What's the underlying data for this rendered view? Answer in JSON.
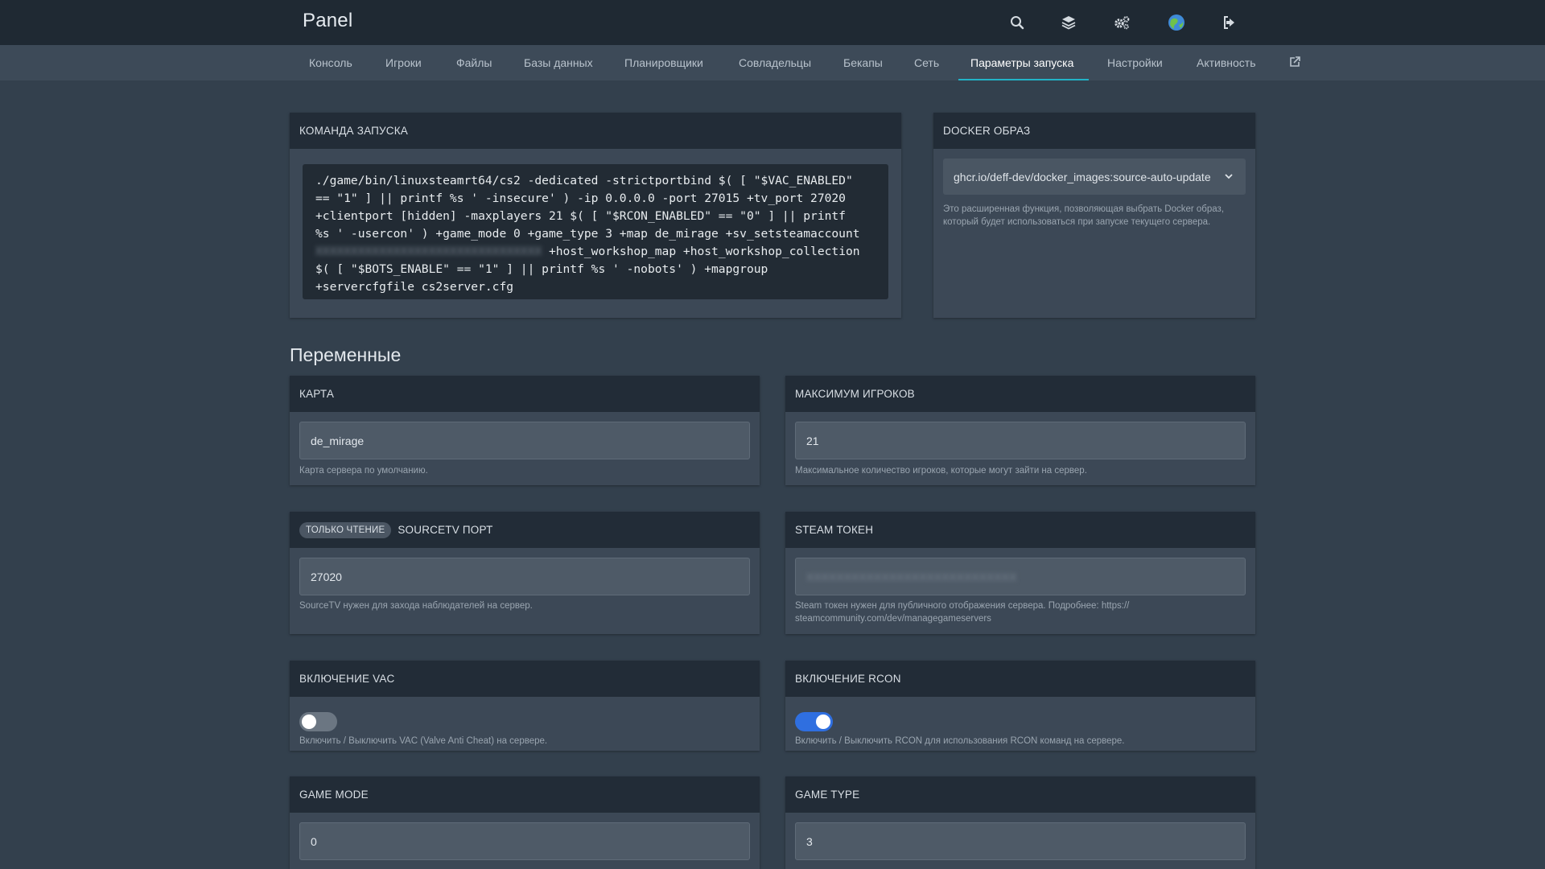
{
  "header": {
    "brand": "Panel",
    "icons": [
      "search-icon",
      "layers-icon",
      "cogs-icon",
      "avatar-globe-icon",
      "logout-icon"
    ]
  },
  "nav": {
    "items": [
      {
        "label": "Консоль"
      },
      {
        "label": "Игроки"
      },
      {
        "label": "Файлы"
      },
      {
        "label": "Базы данных"
      },
      {
        "label": "Планировщики"
      },
      {
        "label": "Совладельцы"
      },
      {
        "label": "Бекапы"
      },
      {
        "label": "Сеть"
      },
      {
        "label": "Параметры запуска",
        "active": true
      },
      {
        "label": "Настройки"
      },
      {
        "label": "Активность"
      }
    ],
    "external_icon": "external-link-icon",
    "active_color": "#22b3c7"
  },
  "startup": {
    "title": "КОМАНДА ЗАПУСКА",
    "lines": [
      "./game/bin/linuxsteamrt64/cs2 -dedicated -strictportbind $( [ \"$VAC_ENABLED\"",
      "== \"1\" ] || printf %s ' -insecure' ) -ip 0.0.0.0 -port 27015 +tv_port 27020",
      "+clientport [hidden] -maxplayers 21 $( [ \"$RCON_ENABLED\" == \"0\" ] || printf",
      "%s ' -usercon' ) +game_mode 0 +game_type 3 +map de_mirage +sv_setsteamaccount",
      "+host_workshop_map +host_workshop_collection",
      "$( [ \"$BOTS_ENABLE\" == \"1\" ] || printf %s ' -nobots' ) +mapgroup",
      "+servercfgfile cs2server.cfg"
    ]
  },
  "docker": {
    "title": "DOCKER ОБРАЗ",
    "selected": "ghcr.io/deff-dev/docker_images:source-auto-update",
    "help_line1": "Это расширенная функция, позволяющая выбрать Docker образ,",
    "help_line2": "который будет использоваться при запуске текущего сервера."
  },
  "variables": {
    "title": "Переменные",
    "map": {
      "title": "КАРТА",
      "value": "de_mirage",
      "help": "Карта сервера по умолчанию."
    },
    "max_players": {
      "title": "МАКСИМУМ ИГРОКОВ",
      "value": "21",
      "help": "Максимальное количество игроков, которые могут зайти на сервер."
    },
    "sourcetv": {
      "badge": "ТОЛЬКО ЧТЕНИЕ",
      "title": "SOURCETV ПОРТ",
      "value": "27020",
      "help": "SourceTV нужен для захода наблюдателей на сервер."
    },
    "steam_token": {
      "title": "STEAM ТОКЕН",
      "help_line1": "Steam токен нужен для публичного отображения сервера. Подробнее: https://",
      "help_line2": "steamcommunity.com/dev/managegameservers"
    },
    "vac": {
      "title": "ВКЛЮЧЕНИЕ VAC",
      "enabled": false,
      "help": "Включить / Выключить VAC (Valve Anti Cheat) на сервере."
    },
    "rcon": {
      "title": "ВКЛЮЧЕНИЕ RCON",
      "enabled": true,
      "help": "Включить / Выключить RCON для использования RCON команд на сервере."
    },
    "game_mode": {
      "title": "GAME MODE",
      "value": "0"
    },
    "game_type": {
      "title": "GAME TYPE",
      "value": "3"
    }
  }
}
